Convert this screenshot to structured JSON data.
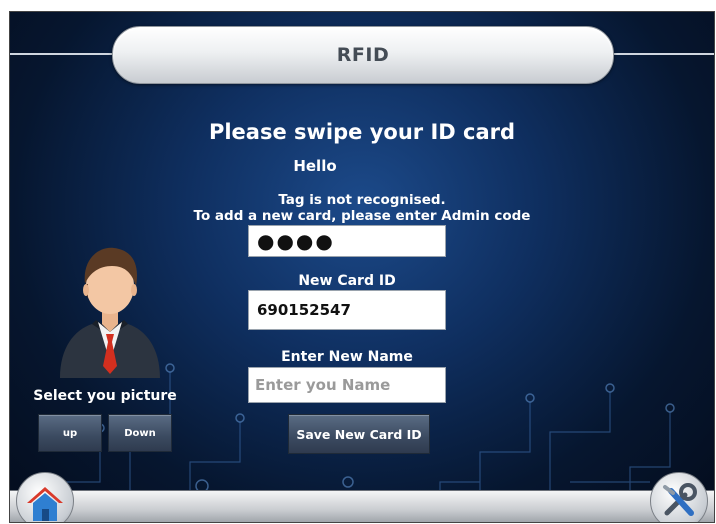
{
  "header": {
    "title": "RFID"
  },
  "main": {
    "heading": "Please swipe your ID card",
    "greeting": "Hello",
    "message_line1": "Tag is not recognised.",
    "message_line2": "To add a new card, please enter Admin code",
    "admin_code": {
      "value": "●●●●"
    },
    "new_card_id": {
      "label": "New Card ID",
      "value": "690152547"
    },
    "new_name": {
      "label": "Enter New Name",
      "value": "",
      "placeholder": "Enter you Name"
    },
    "save_button_label": "Save New Card ID"
  },
  "picture_selector": {
    "label": "Select you picture",
    "up_label": "up",
    "down_label": "Down",
    "avatar_icon": "businessman-avatar-icon"
  },
  "bottom_bar": {
    "home_icon": "home-icon",
    "settings_icon": "tools-icon"
  },
  "colors": {
    "background_dark": "#06162f",
    "background_glow": "#1c4a8a",
    "button": "#3b4a60",
    "text": "#ffffff",
    "title_text": "#444c55",
    "tie": "#d32f1f"
  }
}
